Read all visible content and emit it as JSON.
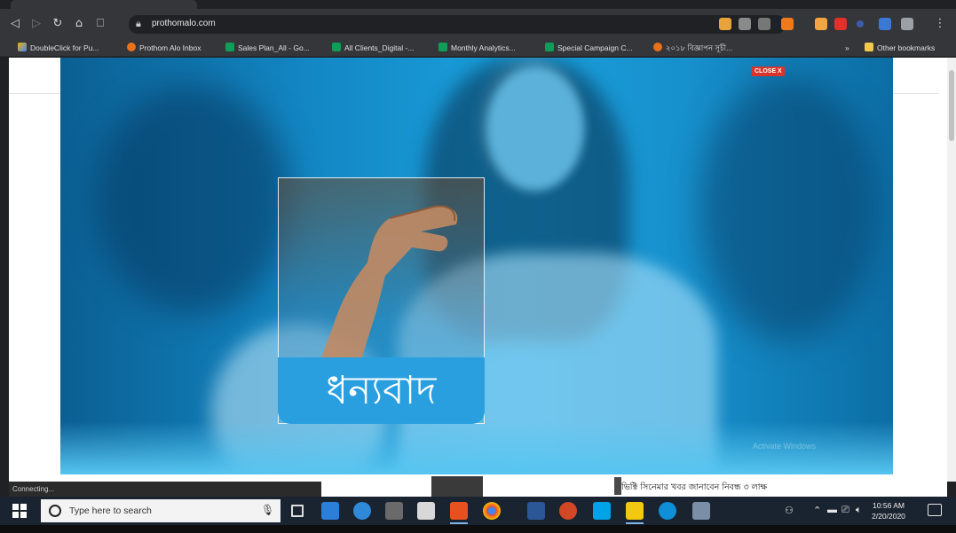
{
  "browser": {
    "address": "prothomalo.com",
    "bookmarks": [
      {
        "label": "DoubleClick for Pu...",
        "icon": "doubleclick-icon"
      },
      {
        "label": "Prothom Alo Inbox",
        "icon": "orange-dot-icon"
      },
      {
        "label": "Sales Plan_All - Go...",
        "icon": "sheets-icon"
      },
      {
        "label": "All Clients_Digital -...",
        "icon": "sheets-icon"
      },
      {
        "label": "Monthly Analytics...",
        "icon": "sheets-icon"
      },
      {
        "label": "Special Campaign C...",
        "icon": "sheets-icon"
      },
      {
        "label": "২০১৮ বিজ্ঞাপন সূচী...",
        "icon": "orange-dot-icon"
      }
    ],
    "bookmarks_overflow": "»",
    "other_bookmarks": "Other bookmarks",
    "status": "Connecting..."
  },
  "ad": {
    "close_label": "CLOSE X",
    "thanks_text": "ধন্যবাদ",
    "watermark": "Activate Windows"
  },
  "news": {
    "headline": "ভিক্টি সিনেমার খবর জানাবেন নিবন্ধ ৩ লাক্ষ"
  },
  "taskbar": {
    "search_placeholder": "Type here to search",
    "time": "10:56 AM",
    "date": "2/20/2020"
  },
  "colors": {
    "ad_blue": "#1aa0dd",
    "close_red": "#d8342c",
    "thanks_band": "#2a9fe0",
    "taskbar": "#1a2330"
  }
}
